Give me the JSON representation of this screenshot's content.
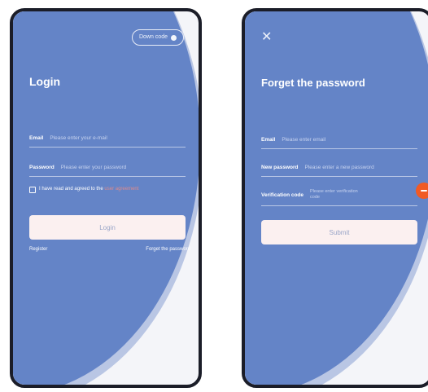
{
  "login": {
    "chip_label": "Down code",
    "title": "Login",
    "email_label": "Email",
    "email_placeholder": "Please enter your e-mail",
    "password_label": "Password",
    "password_placeholder": "Please enter your password",
    "agree_text": "I have read and agreed to the",
    "agree_link": "user agreement",
    "agree_text2": "user",
    "login_button": "Login",
    "register_link": "Register",
    "forgot_link": "Forget the password"
  },
  "forgot": {
    "close_icon": "close-icon",
    "title": "Forget the password",
    "email_label": "Email",
    "email_placeholder": "Please enter email",
    "new_password_label": "New password",
    "new_password_placeholder": "Please enter a new password",
    "code_label": "Verification code",
    "code_placeholder": "Please enter verification code",
    "submit_button": "Submit"
  },
  "colors": {
    "primary_blue": "#6484c7",
    "button_bg": "#fbf0f0",
    "accent_orange": "#f15a24",
    "phone_frame": "#1b1d28"
  }
}
